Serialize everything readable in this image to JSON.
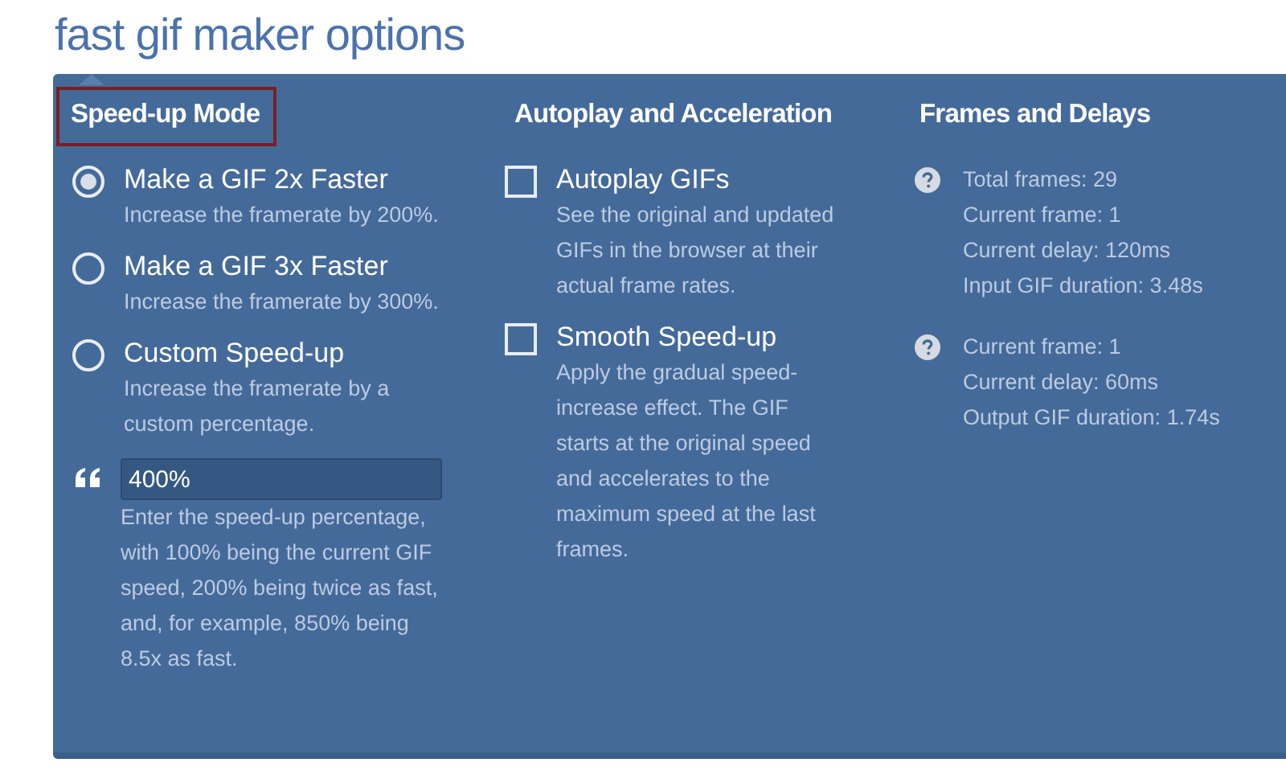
{
  "title": "fast gif maker options",
  "sections": [
    {
      "heading": "Speed-up Mode",
      "highlighted": true,
      "options": [
        {
          "kind": "radio",
          "label": "Make a GIF 2x Faster",
          "description": "Increase the framerate by 200%.",
          "selected": true
        },
        {
          "kind": "radio",
          "label": "Make a GIF 3x Faster",
          "description": "Increase the framerate by 300%.",
          "selected": false
        },
        {
          "kind": "radio",
          "label": "Custom Speed-up",
          "description": "Increase the framerate by a custom percentage.",
          "selected": false
        },
        {
          "kind": "input",
          "value": "400%",
          "description": "Enter the speed-up percentage, with 100% being the current GIF speed, 200% being twice as fast, and, for example, 850% being 8.5x as fast."
        }
      ]
    },
    {
      "heading": "Autoplay and Acceleration",
      "highlighted": false,
      "options": [
        {
          "kind": "checkbox",
          "label": "Autoplay GIFs",
          "description": "See the original and updated GIFs in the browser at their actual frame rates.",
          "checked": false
        },
        {
          "kind": "checkbox",
          "label": "Smooth Speed-up",
          "description": "Apply the gradual speed-increase effect. The GIF starts at the original speed and accelerates to the maximum speed at the last frames.",
          "checked": false
        }
      ]
    },
    {
      "heading": "Frames and Delays",
      "highlighted": false,
      "options": [
        {
          "kind": "info",
          "lines": [
            "Total frames: 29",
            "Current frame: 1",
            "Current delay: 120ms",
            "Input GIF duration: 3.48s"
          ]
        },
        {
          "kind": "info",
          "lines": [
            "Current frame: 1",
            "Current delay: 60ms",
            "Output GIF duration: 1.74s"
          ]
        }
      ]
    }
  ]
}
